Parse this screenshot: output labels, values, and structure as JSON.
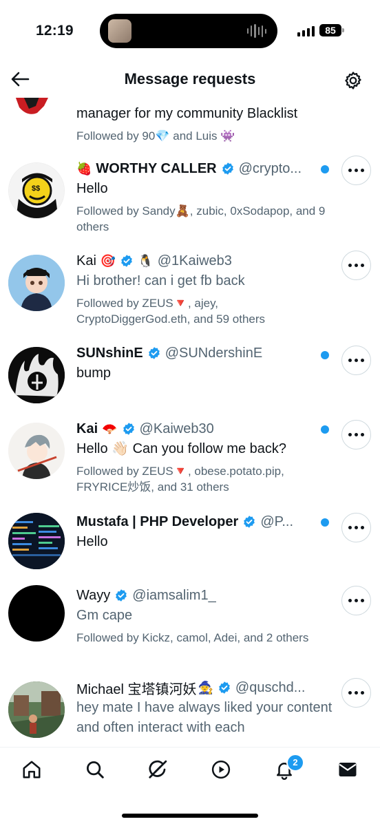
{
  "status_bar": {
    "time": "12:19",
    "battery": "85"
  },
  "header": {
    "title": "Message requests"
  },
  "requests": [
    {
      "partial_message": "manager for my community Blacklist",
      "followed_by": "Followed by 90💎 and Luis 👾"
    },
    {
      "name": "WORTHY CALLER",
      "name_prefix_emoji": "🍓",
      "handle": "@crypto...",
      "message": "Hello",
      "followed_by": "Followed by Sandy🧸, zubic, 0xSodapop, and 9 others",
      "unread": true
    },
    {
      "name": "Kai",
      "name_emoji": "🎯",
      "extra_emoji": "🐧",
      "handle": "@1Kaiweb3",
      "message": "Hi brother! can i get fb back",
      "followed_by": "Followed by ZEUS🔻, ajey, CryptoDiggerGod.eth, and 59 others",
      "unread": false
    },
    {
      "name": "SUNshinE",
      "handle": "@SUNdershinE",
      "message": "bump",
      "unread": true
    },
    {
      "name": "Kai",
      "name_emoji": "🪭",
      "handle": "@Kaiweb30",
      "message": "Hello 👋🏻 Can you follow me back?",
      "followed_by": "Followed by ZEUS🔻, obese.potato.pip, FRYRICE炒饭, and 31 others",
      "unread": true
    },
    {
      "name": "Mustafa | PHP Developer",
      "handle": "@P...",
      "message": "Hello",
      "unread": true
    },
    {
      "name": "Wayy",
      "handle": "@iamsalim1_",
      "message": "Gm cape",
      "followed_by": "Followed by Kickz, camol, Adei, and 2 others",
      "unread": false
    },
    {
      "name": "Michael 宝塔镇河妖",
      "name_emoji": "🧙",
      "handle": "@quschd...",
      "message": "hey mate I have always liked your content and often interact with each",
      "unread": false
    }
  ],
  "bottom_nav": {
    "items": [
      "home",
      "search",
      "grok",
      "video",
      "notifications",
      "messages"
    ],
    "notification_count": "2"
  },
  "colors": {
    "accent": "#1d9bf0",
    "text": "#0f1419",
    "muted": "#536471",
    "border": "#cfd9de"
  },
  "icons": [
    "back-arrow-icon",
    "gear-icon",
    "verified-icon",
    "more-icon",
    "home-icon",
    "search-icon",
    "grok-icon",
    "video-icon",
    "bell-icon",
    "mail-icon"
  ]
}
